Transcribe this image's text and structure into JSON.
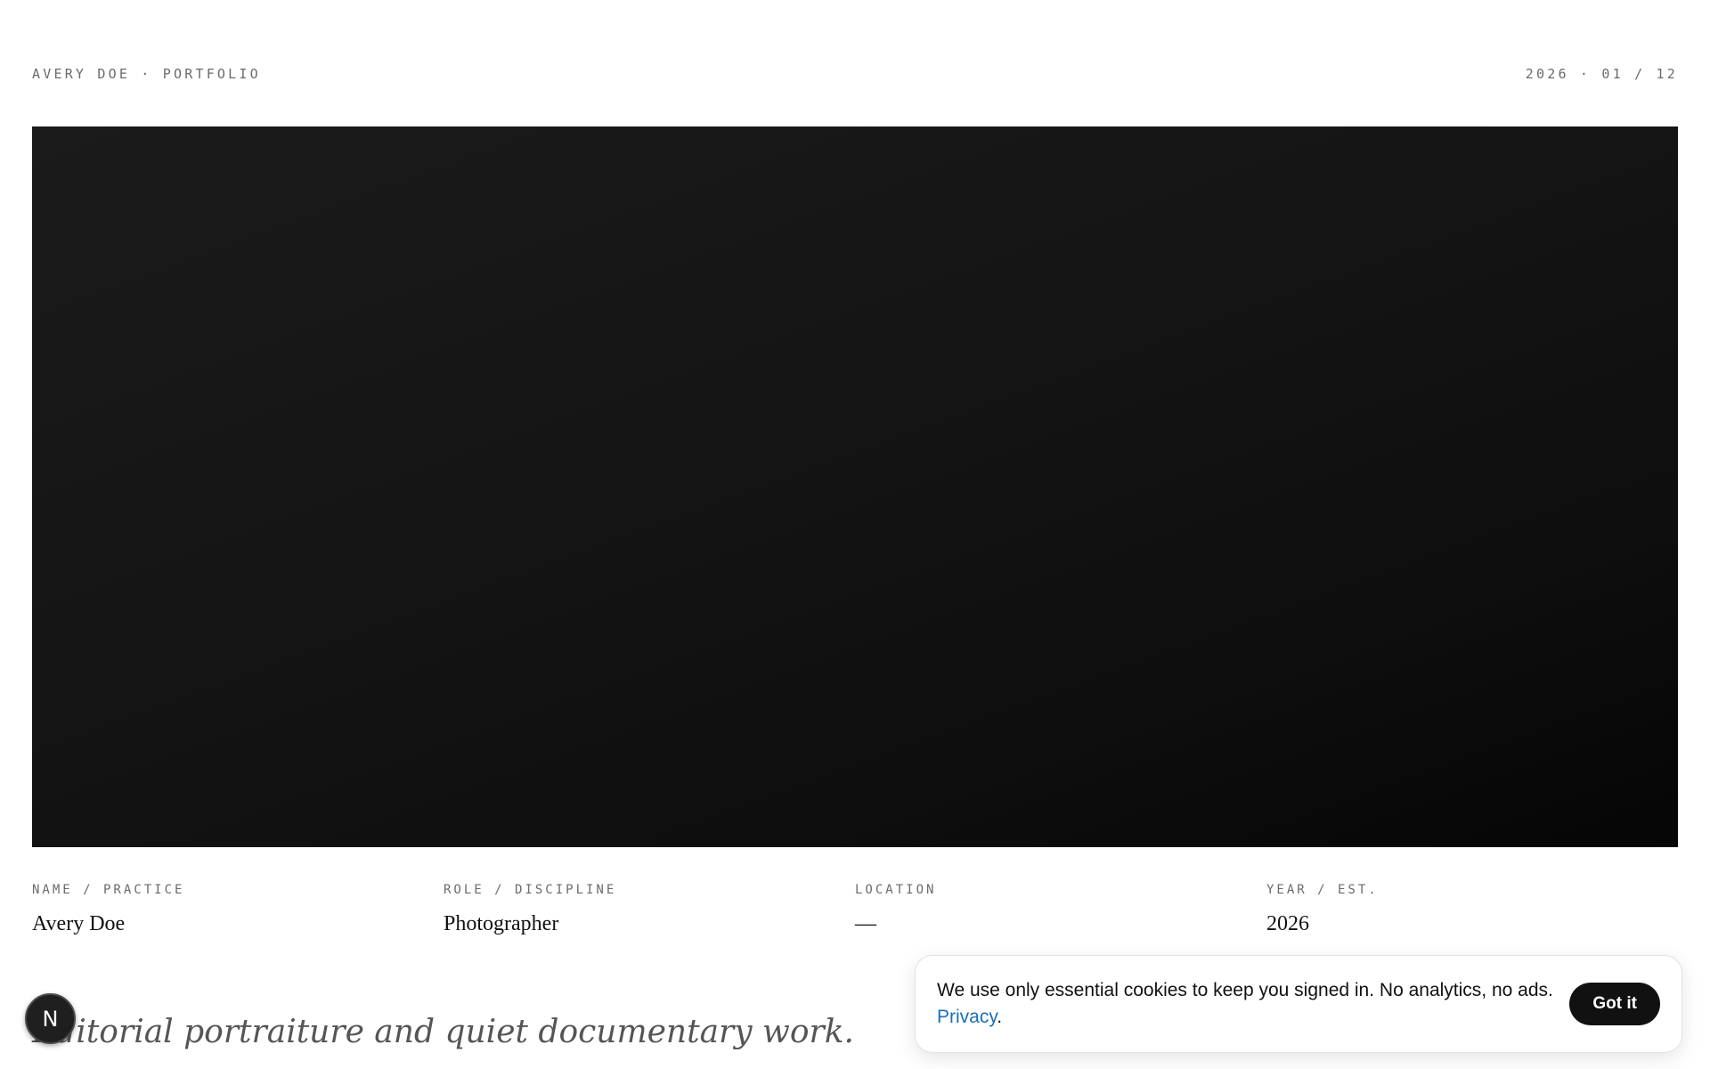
{
  "header": {
    "left_label": "AVERY DOE · PORTFOLIO",
    "right_label": "2026 · 01 / 12"
  },
  "meta": [
    {
      "label": "NAME / PRACTICE",
      "value": "Avery Doe"
    },
    {
      "label": "ROLE / DISCIPLINE",
      "value": "Photographer"
    },
    {
      "label": "LOCATION",
      "value": "—"
    },
    {
      "label": "YEAR / EST.",
      "value": "2026"
    }
  ],
  "tagline": "Editorial portraiture and quiet documentary work.",
  "badge": {
    "letter": "N"
  },
  "cookie": {
    "message": "We use only essential cookies to keep you signed in. No analytics, no ads.",
    "link_label": "Privacy",
    "link_suffix": ".",
    "button_label": "Got it"
  },
  "colors": {
    "hero_dark": "#111111",
    "link": "#1a6fb5",
    "button": "#111111"
  }
}
